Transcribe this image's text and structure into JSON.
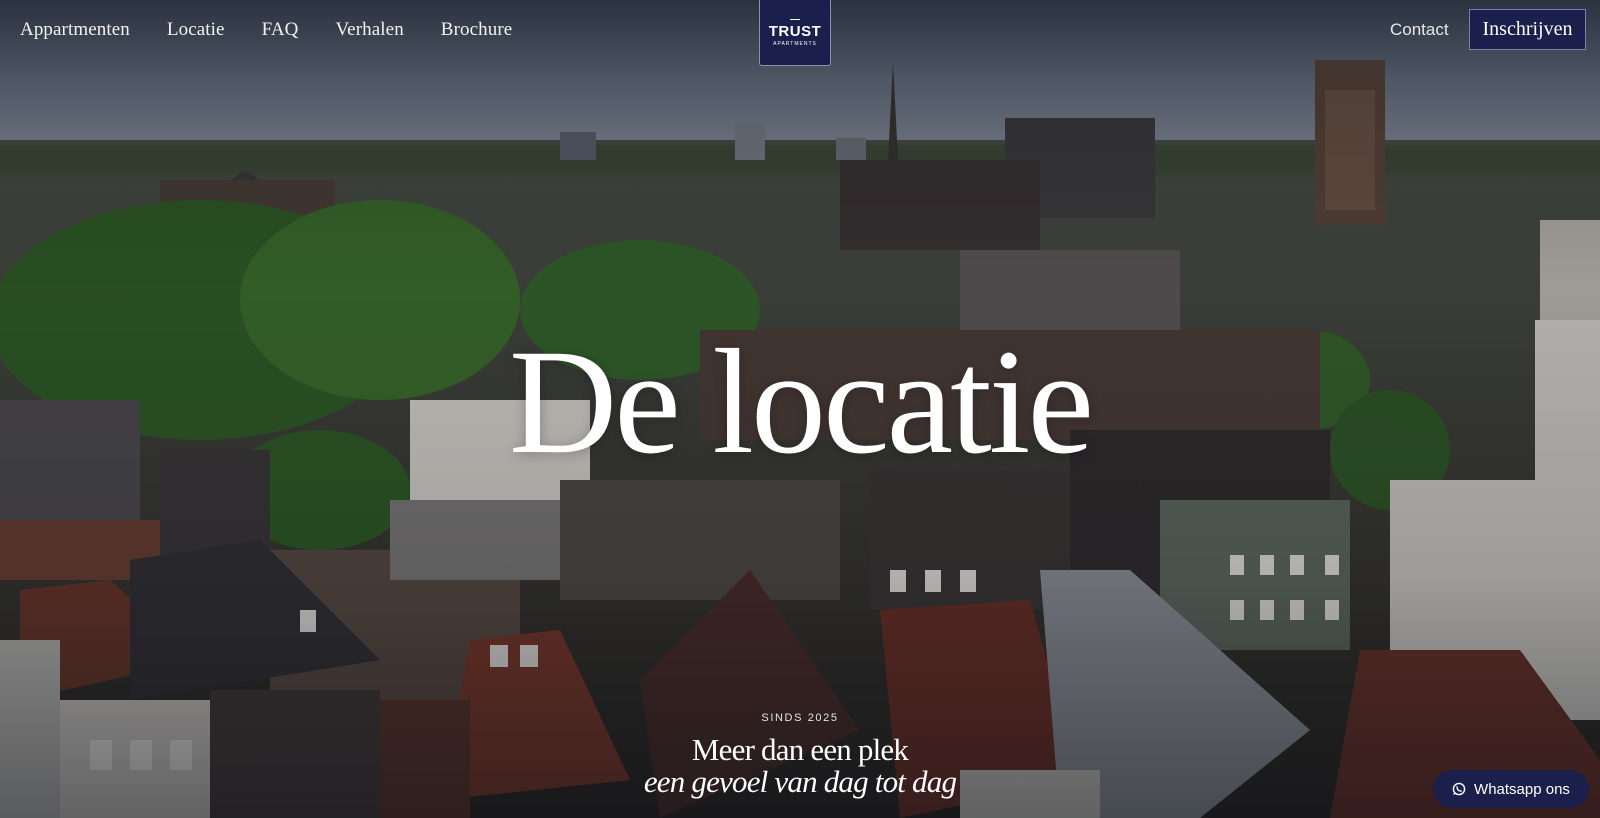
{
  "nav": {
    "links": [
      "Appartmenten",
      "Locatie",
      "FAQ",
      "Verhalen",
      "Brochure"
    ],
    "contact_label": "Contact",
    "signup_label": "Inschrijven"
  },
  "logo": {
    "title": "TRUST",
    "subtitle": "APARTMENTS"
  },
  "hero": {
    "title": "De locatie",
    "since": "SINDS 2025",
    "tagline": "Meer dan een plek",
    "tagline_sub": "een gevoel van dag tot dag"
  },
  "whatsapp": {
    "label": "Whatsapp ons",
    "icon": "whatsapp-icon"
  },
  "colors": {
    "brand_navy": "#1b1f4b",
    "text_light": "#ffffff"
  }
}
